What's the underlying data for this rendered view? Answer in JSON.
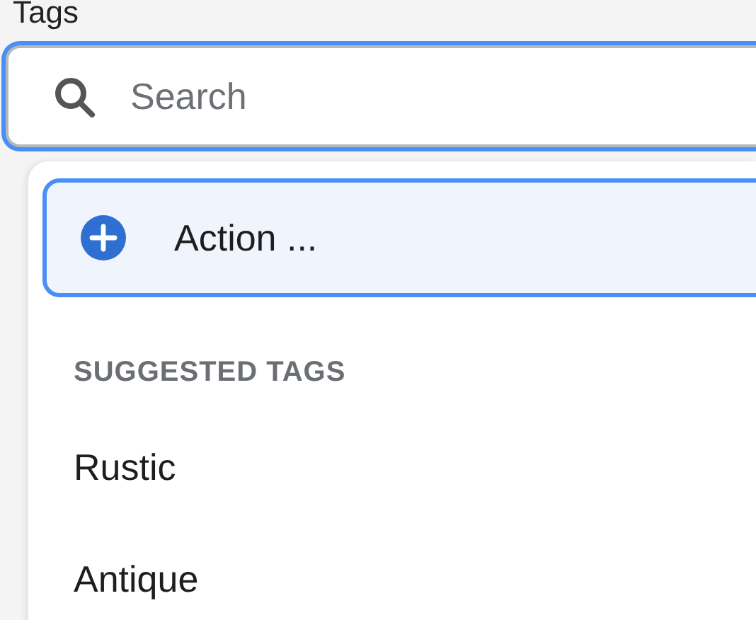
{
  "label": "Tags",
  "search": {
    "placeholder": "Search",
    "focused": true
  },
  "menu": {
    "action": {
      "label": "Action ...",
      "selected": true
    },
    "heading": "SUGGESTED TAGS",
    "items": [
      {
        "label": "Rustic",
        "selected": false
      },
      {
        "label": "Antique",
        "selected": false
      }
    ]
  }
}
